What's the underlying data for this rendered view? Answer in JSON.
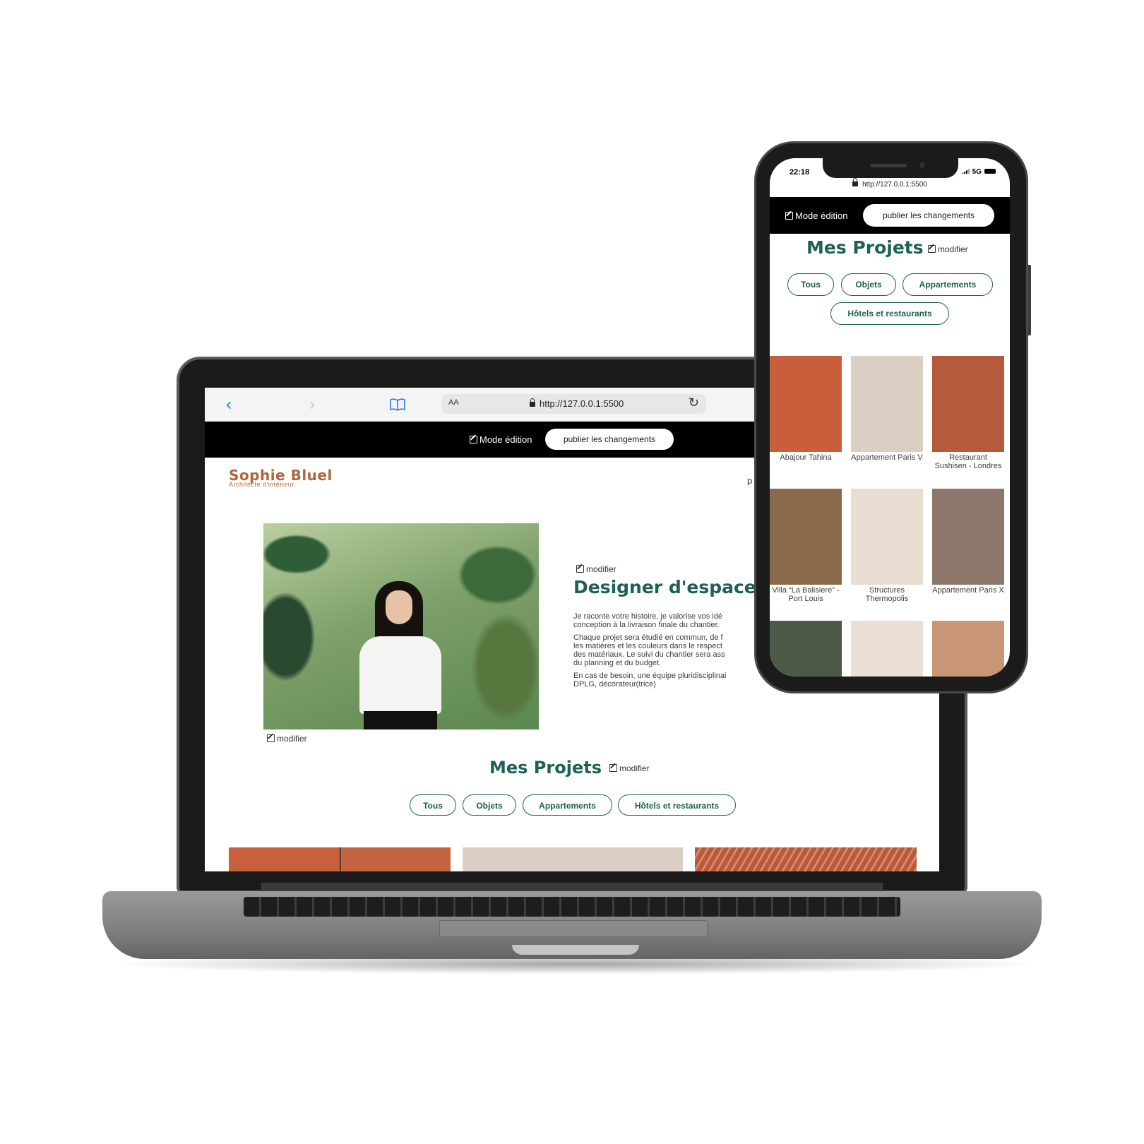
{
  "laptop": {
    "browser": {
      "text_size": "AA",
      "url": "http://127.0.0.1:5500"
    },
    "edit_bar": {
      "mode_label": "Mode édition",
      "publish_label": "publier les changements"
    },
    "header": {
      "logo": "Sophie Bluel",
      "subtitle": "Architecte d'intérieur",
      "nav_partial": "p"
    },
    "intro": {
      "modify_label": "modifier",
      "title": "Designer d'espace",
      "paragraphs": [
        "Je raconte votre histoire, je valorise vos idé",
        "conception à la livraison finale du chantier.",
        "Chaque projet sera étudié en commun, de f",
        "les matières et les couleurs dans le respect",
        "des matériaux. Le suivi du chantier sera ass",
        "du planning et du budget.",
        "En cas de besoin, une équipe pluridisciplinai",
        "DPLG, décorateur(trice)"
      ],
      "photo_modify_label": "modifier"
    },
    "projects": {
      "title": "Mes Projets",
      "modify_label": "modifier",
      "filters": [
        "Tous",
        "Objets",
        "Appartements",
        "Hôtels et restaurants"
      ]
    }
  },
  "phone": {
    "status": {
      "time": "22:18",
      "network": "5G"
    },
    "url": "http://127.0.0.1:5500",
    "edit_bar": {
      "mode_label": "Mode édition",
      "publish_label": "publier les changements"
    },
    "projects": {
      "title": "Mes Projets",
      "modify_label": "modifier",
      "filters": [
        "Tous",
        "Objets",
        "Appartements",
        "Hôtels et restaurants"
      ],
      "items": [
        {
          "caption": "Abajour Tahina",
          "color": "#c95e3c"
        },
        {
          "caption": "Appartement Paris V",
          "color": "#d9cfc2"
        },
        {
          "caption": "Restaurant Sushisen - Londres",
          "color": "#b65a3e"
        },
        {
          "caption": "Villa “La Balisiere” - Port Louis",
          "color": "#8a6a4a"
        },
        {
          "caption": "Structures Thermopolis",
          "color": "#e8ddd1"
        },
        {
          "caption": "Appartement Paris X",
          "color": "#8c776a"
        },
        {
          "caption": "",
          "color": "#4d5a48"
        },
        {
          "caption": "",
          "color": "#e9dfd4"
        },
        {
          "caption": "",
          "color": "#c99577"
        }
      ]
    }
  },
  "colors": {
    "accent_green": "#1d6154",
    "brand_orange": "#b1663c",
    "edit_bar": "#000000"
  }
}
